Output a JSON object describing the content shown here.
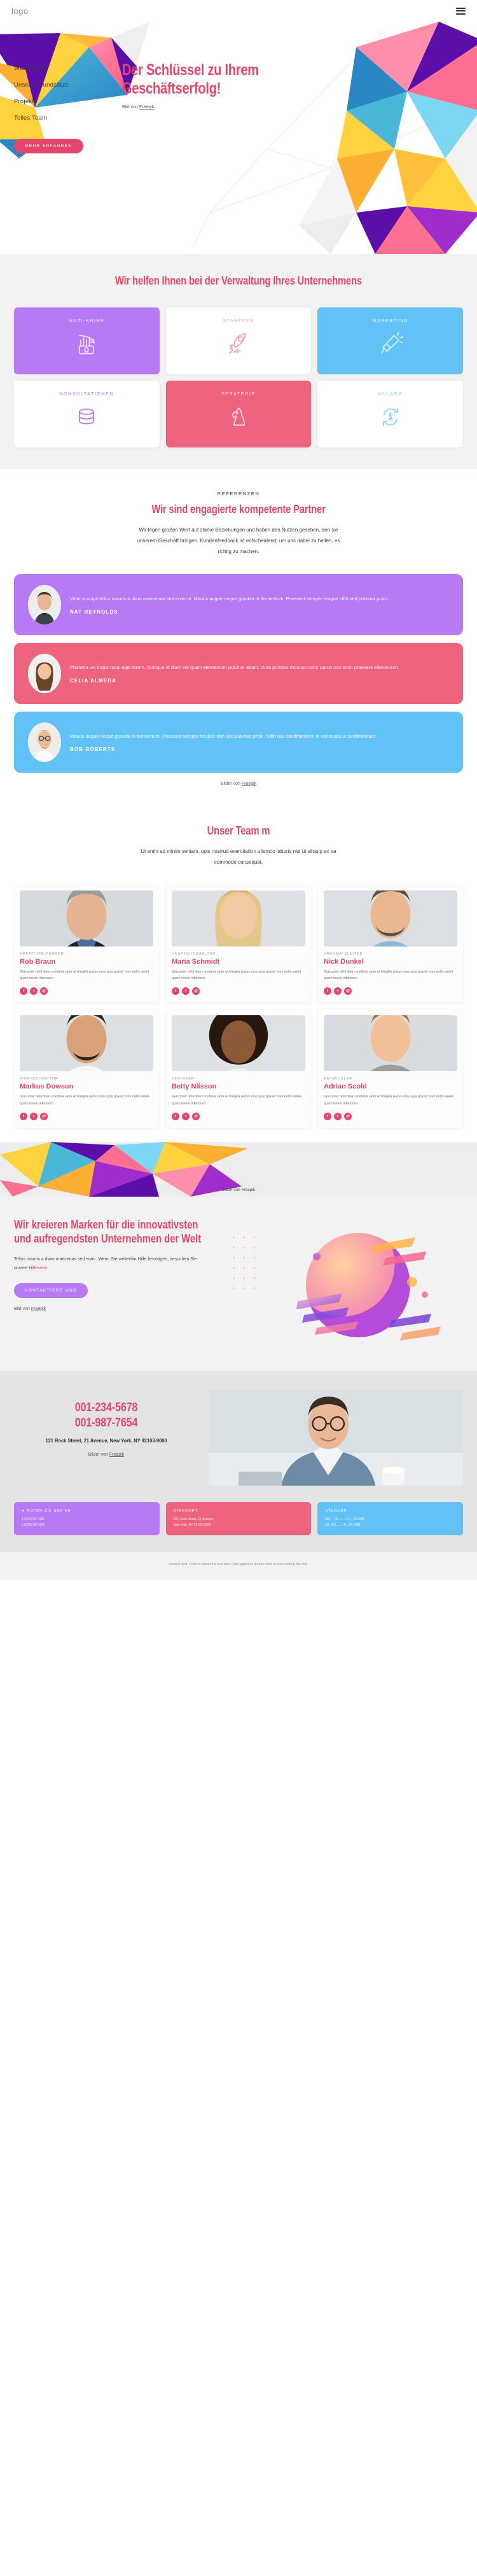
{
  "header": {
    "logo": "logo",
    "menu_icon": "hamburger-menu"
  },
  "hero": {
    "nav": [
      {
        "label": "Was wir tun"
      },
      {
        "label": "Unsere Grundsätze"
      },
      {
        "label": "Projekte"
      },
      {
        "label": "Tolles Team"
      }
    ],
    "cta": "MEHR ERFAHREN",
    "title": "Der Schlüssel zu Ihrem Geschäftserfolg!",
    "credit_prefix": "Bild von ",
    "credit_link": "Freepik"
  },
  "services": {
    "title": "Wir helfen Ihnen bei der Verwaltung Ihres Unternehmens",
    "cards": [
      {
        "label": "ANTI-KRISE",
        "icon": "money-chart-icon",
        "bg": "#b77af4",
        "fg": "#f0dcff"
      },
      {
        "label": "STARTUPS",
        "icon": "rocket-icon",
        "bg": "#ffffff",
        "fg": "#efa3b4"
      },
      {
        "label": "MARKETING",
        "icon": "megaphone-icon",
        "bg": "#63c2f5",
        "fg": "#d3eefd"
      },
      {
        "label": "KONSULTATIONEN",
        "icon": "coins-icon",
        "bg": "#ffffff",
        "fg": "#b77af4"
      },
      {
        "label": "STRATEGIE",
        "icon": "chess-knight-icon",
        "bg": "#ee637d",
        "fg": "#ffd8e0"
      },
      {
        "label": "ANLAGE",
        "icon": "refresh-dollar-icon",
        "bg": "#ffffff",
        "fg": "#8fd4f6"
      }
    ]
  },
  "testimonials": {
    "eyebrow": "REFERENZEN",
    "title": "Wir sind engagierte kompetente Partner",
    "intro": "Wir legen großen Wert auf starke Beziehungen und haben den Nutzen gesehen, den sie unserem Geschäft bringen. Kundenfeedback ist entscheidend, um uns dabei zu helfen, es richtig zu machen.",
    "items": [
      {
        "quote": "Vitae suscipit tellus mauris a diam maecenas sed enim ut. Mauris augue neque gravida in fermentum. Praesent semper feugiat nibh sed pulvinar proin.",
        "name": "NAT REYNOLDS",
        "bg": "#b77af4",
        "avatar": "male-avatar-1"
      },
      {
        "quote": "Pharetra vel turpis nunc eget lorem. Quisque id diam vel quam elementum pulvinar etiam. Urna porttitor rhoncus dolor purus non enim praesent elementum.",
        "name": "CELIA ALMEDA",
        "bg": "#ee637d",
        "avatar": "female-avatar-1"
      },
      {
        "quote": "Mauris augue neque gravida in fermentum. Praesent semper feugiat nibh sed pulvinar proin. Nibh nisl condimentum id venenatis a condimentum.",
        "name": "BOB ROBERTS",
        "bg": "#63c2f5",
        "avatar": "male-avatar-2"
      }
    ],
    "credit_prefix": "Bilder von ",
    "credit_link": "Freepik"
  },
  "team": {
    "title": "Unser Team m",
    "intro": "Ut enim ad minim veniam, quis nostrud exercitation ullamco laboris nisi ut aliquip ex ea commodo consequat.",
    "bio": "Giacumet nihil libero mobisle ante ut fringilla purus eros quis gravid hom dolor amet quam lorem iidendum.",
    "members": [
      {
        "role": "KREATIVER FÜHRER",
        "name": "Rob Braun",
        "photo": "man-suit-photo"
      },
      {
        "role": "HAUPTBUCHHALTER",
        "name": "Maria Schmidt",
        "photo": "woman-blonde-photo"
      },
      {
        "role": "VERKAUFSLEITER",
        "name": "Nick Dunkel",
        "photo": "man-blueshirt-photo"
      },
      {
        "role": "FINANZDIREKTOR",
        "name": "Markus Dowson",
        "photo": "man-white-tshirt-photo"
      },
      {
        "role": "DESIGNER",
        "name": "Betty Nilsson",
        "photo": "woman-curly-photo"
      },
      {
        "role": "ENTWICKLER",
        "name": "Adrian Scold",
        "photo": "man-hoodie-photo"
      }
    ],
    "socials": [
      "f",
      "t",
      "@"
    ],
    "strip_credit": "Bilder von Freepik"
  },
  "brand": {
    "title": "Wir kreieren Marken für die innovativsten und aufregendsten Unternehmen der Welt",
    "paragraph": "Tellus mauris a diam maecenas sed enim. Wenn Sie weiterhin Hilfe benötigen, besuchen Sie unsere ",
    "paragraph_link": "Hilfeseite",
    "paragraph_end": ".",
    "cta": "KONTAKTIERE UNS",
    "credit_prefix": "Bild von ",
    "credit_link": "Freepik"
  },
  "contact": {
    "phone1": "001-234-5678",
    "phone2": "001-987-7654",
    "address": "121 Rock Street, 21 Avenue, New York, NY 92103-9000",
    "credit_prefix": "Bilder von ",
    "credit_link": "Freepik",
    "photo": "man-glasses-desk-photo",
    "boxes": [
      {
        "title": "★ RUFEN SIE UNS AN",
        "lines": [
          "1 (234) 567-891",
          "1 (234) 987-654"
        ],
        "bg": "#b77af4"
      },
      {
        "title": "STANDORT",
        "lines": [
          "121 Rock Street, 21 Avenue,",
          "New York, NY 92103-9000"
        ],
        "bg": "#ee637d"
      },
      {
        "title": "STUNDEN",
        "lines": [
          "MO – FR ....... 11 – 23 UHR",
          "SA, SO ....... 8 – 20 UHR"
        ],
        "bg": "#63c2f5"
      }
    ]
  },
  "footer": {
    "note": "Sample text. Click to select the text box. Click again or double click to start editing the text."
  }
}
